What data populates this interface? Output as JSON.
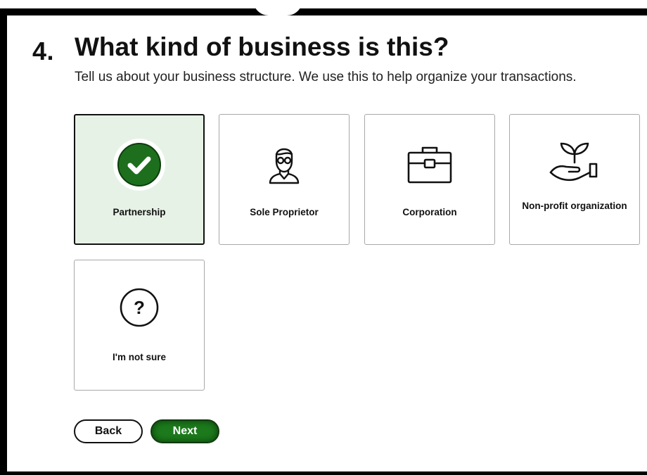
{
  "step": {
    "number": "4.",
    "title": "What kind of business is this?",
    "subtitle": "Tell us about your business structure. We use this to help organize your transactions."
  },
  "options": [
    {
      "label": "Partnership",
      "icon": "checkmark-circle-icon",
      "selected": true
    },
    {
      "label": "Sole Proprietor",
      "icon": "person-icon",
      "selected": false
    },
    {
      "label": "Corporation",
      "icon": "briefcase-icon",
      "selected": false
    },
    {
      "label": "Non-profit organization",
      "icon": "plant-hand-icon",
      "selected": false
    },
    {
      "label": "I'm not sure",
      "icon": "question-circle-icon",
      "selected": false
    }
  ],
  "buttons": {
    "back": "Back",
    "next": "Next"
  },
  "colors": {
    "selected_bg": "#e7f2e7",
    "accent_green": "#1c7a1c",
    "check_green": "#1d6f1d"
  }
}
